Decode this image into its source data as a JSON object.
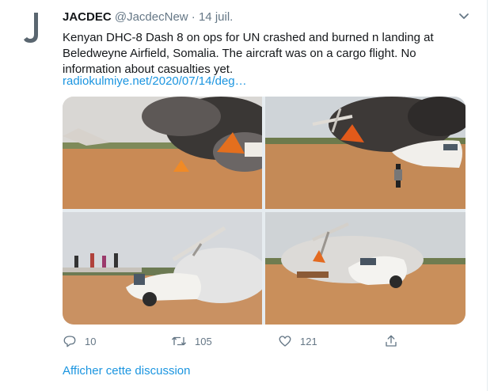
{
  "tweet": {
    "author_name": "JACDEC",
    "handle": "@JacdecNew",
    "separator": "·",
    "date": "14 juil.",
    "avatar_letter": "J",
    "text": "Kenyan DHC-8 Dash 8 on ops for UN crashed and burned n landing at Beledweyne Airfield, Somalia. The aircraft was on a cargo flight. No information about casualties yet.",
    "link": "radiokulmiye.net/2020/07/14/deg…",
    "media": [
      {
        "name": "crash-photo-fire-wide",
        "icon": "photo"
      },
      {
        "name": "crash-photo-wreckage-smoke",
        "icon": "photo"
      },
      {
        "name": "crash-photo-bystanders",
        "icon": "photo"
      },
      {
        "name": "crash-photo-wreckage-side",
        "icon": "photo"
      }
    ],
    "actions": {
      "replies": "10",
      "retweets": "105",
      "likes": "121"
    },
    "show_thread": "Afficher cette discussion"
  },
  "colors": {
    "accent": "#1b95e0",
    "muted": "#657786",
    "text": "#14171a",
    "border": "#e6ecf0"
  }
}
